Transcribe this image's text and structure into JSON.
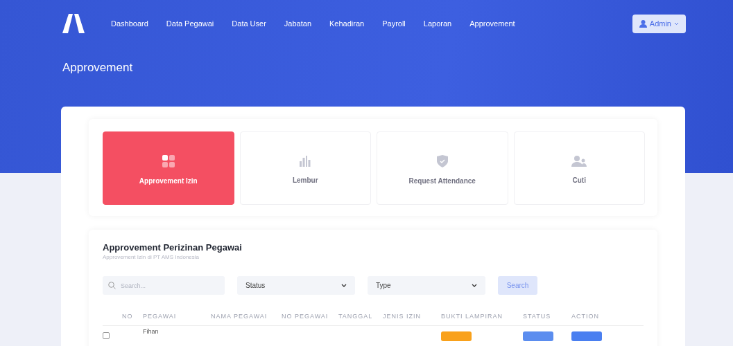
{
  "nav": {
    "items": [
      {
        "label": "Dashboard"
      },
      {
        "label": "Data Pegawai"
      },
      {
        "label": "Data User"
      },
      {
        "label": "Jabatan"
      },
      {
        "label": "Kehadiran"
      },
      {
        "label": "Payroll"
      },
      {
        "label": "Laporan"
      },
      {
        "label": "Approvement"
      }
    ],
    "user": "Admin"
  },
  "page_title": "Approvement",
  "tiles": [
    {
      "kind": "grid",
      "label": "Approvement Izin",
      "selected": true
    },
    {
      "kind": "bars",
      "label": "Lembur",
      "selected": false
    },
    {
      "kind": "shield",
      "label": "Request Attendance",
      "selected": false
    },
    {
      "kind": "people",
      "label": "Cuti",
      "selected": false
    }
  ],
  "section": {
    "title": "Approvement Perizinan Pegawai",
    "subtitle": "Approvement Izin di PT AMS Indonesia"
  },
  "filters": {
    "search_placeholder": "Search...",
    "status": "Status",
    "type": "Type",
    "button": "Search"
  },
  "table": {
    "columns": [
      "NO",
      "PEGAWAI",
      "NAMA PEGAWAI",
      "NO PEGAWAI",
      "TANGGAL",
      "JENIS IZIN",
      "BUKTI LAMPIRAN",
      "STATUS",
      "ACTION"
    ],
    "rows": [
      {
        "checked": false,
        "pegawai": "Fihan"
      }
    ]
  }
}
